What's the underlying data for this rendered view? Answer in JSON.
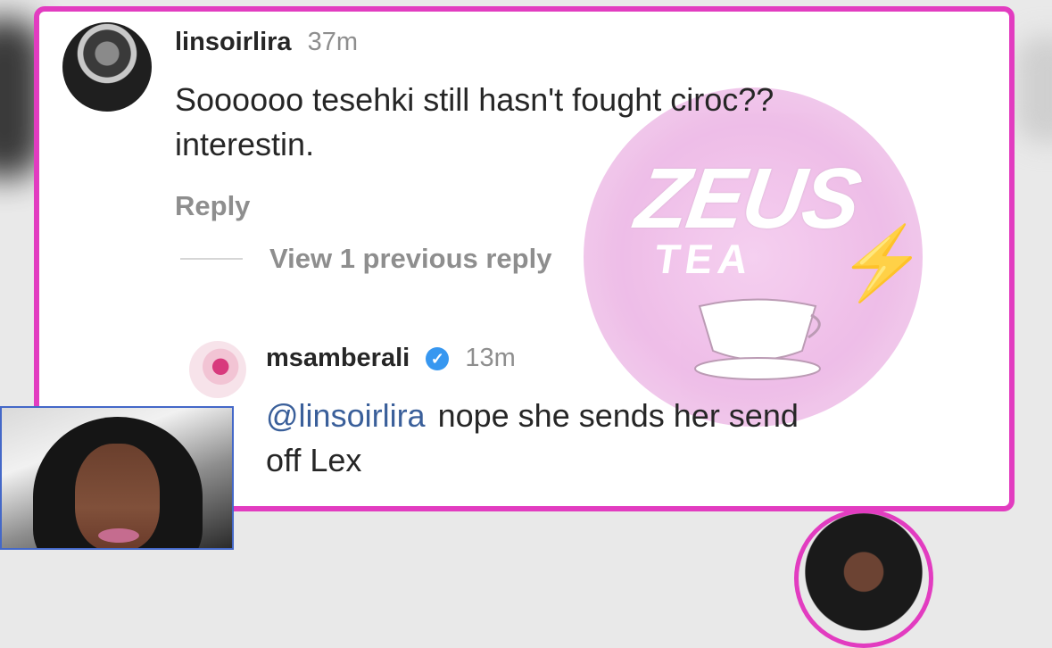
{
  "comment": {
    "username": "linsoirlira",
    "time": "37m",
    "text_line1": "Soooooo tesehki still hasn't fought ciroc??",
    "text_line2": "interestin.",
    "reply_label": "Reply",
    "view_previous": "View 1 previous reply"
  },
  "reply": {
    "username": "msamberali",
    "time": "13m",
    "mention": "@linsoirlira",
    "text_line1": "nope she sends her send",
    "text_line2": "off Lex",
    "verified_icon": "verified-badge-icon"
  },
  "watermark": {
    "title": "ZEUS",
    "subtitle": "TEA"
  },
  "colors": {
    "frame_border": "#e23cc0",
    "username": "#262626",
    "muted": "#8e8e8e",
    "mention": "#3a5f9a",
    "verified": "#3797f0"
  }
}
